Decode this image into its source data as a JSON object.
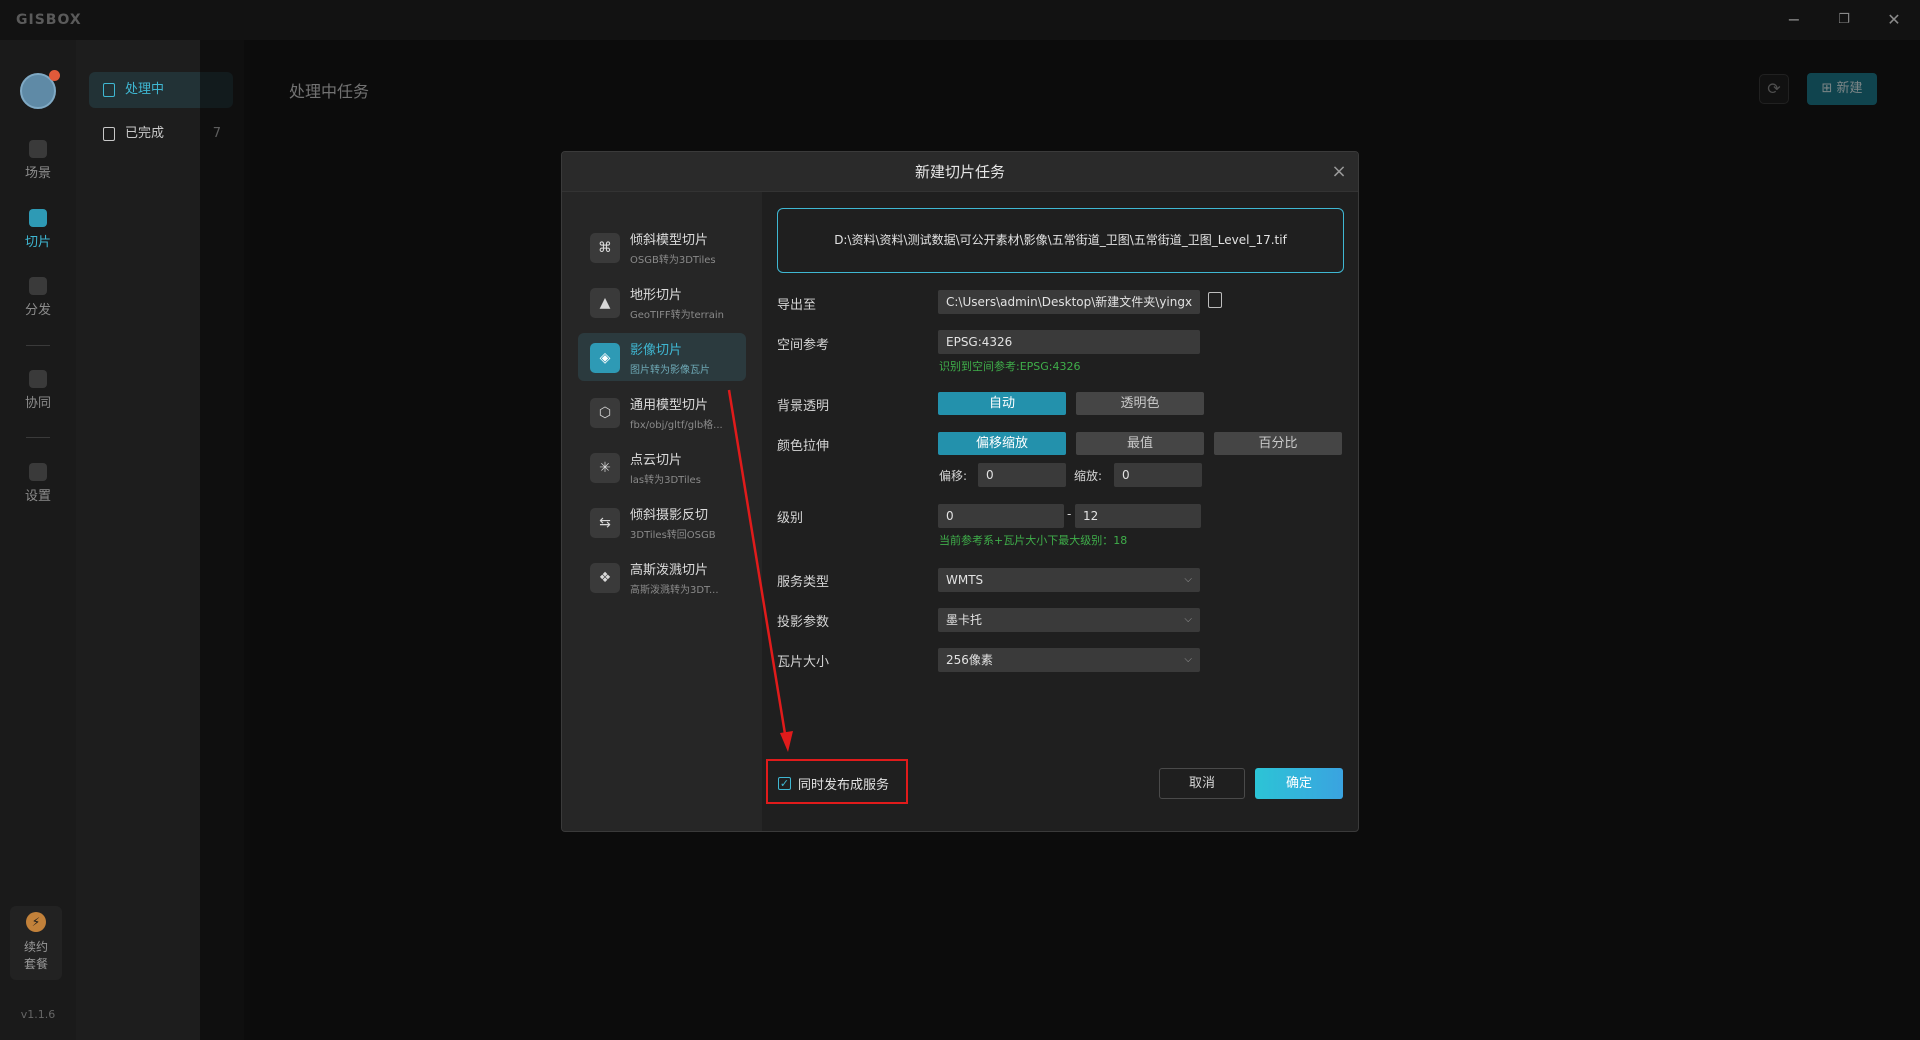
{
  "app": {
    "logo": "GISBOX",
    "version": "v1.1.6",
    "window_controls": {
      "minimize": "−",
      "restore": "❐",
      "close": "✕"
    }
  },
  "rail": {
    "items": [
      {
        "label": "场景",
        "icon": "home-icon"
      },
      {
        "label": "切片",
        "icon": "slice-icon"
      },
      {
        "label": "分发",
        "icon": "distribute-icon"
      },
      {
        "label": "协同",
        "icon": "lock-icon"
      },
      {
        "label": "设置",
        "icon": "gear-icon"
      }
    ],
    "renew": {
      "line1": "续约",
      "line2": "套餐",
      "icon": "bolt-icon"
    }
  },
  "side": {
    "items": [
      {
        "label": "处理中",
        "count": ""
      },
      {
        "label": "已完成",
        "count": "7"
      }
    ]
  },
  "main": {
    "title": "处理中任务",
    "new_label": "新建",
    "refresh_icon": "refresh-icon"
  },
  "dialog": {
    "title": "新建切片任务",
    "close": "×",
    "tasks": [
      {
        "name": "倾斜模型切片",
        "desc": "OSGB转为3DTiles"
      },
      {
        "name": "地形切片",
        "desc": "GeoTIFF转为terrain"
      },
      {
        "name": "影像切片",
        "desc": "图片转为影像瓦片"
      },
      {
        "name": "通用模型切片",
        "desc": "fbx/obj/gltf/glb格..."
      },
      {
        "name": "点云切片",
        "desc": "las转为3DTiles"
      },
      {
        "name": "倾斜摄影反切",
        "desc": "3DTiles转回OSGB"
      },
      {
        "name": "高斯泼溅切片",
        "desc": "高斯泼溅转为3DT..."
      }
    ],
    "file_path": "D:\\资料\\资料\\测试数据\\可公开素材\\影像\\五常街道_卫图\\五常街道_卫图_Level_17.tif",
    "fields": {
      "export_label": "导出至",
      "export_value": "C:\\Users\\admin\\Desktop\\新建文件夹\\yingxiang",
      "spatial_label": "空间参考",
      "spatial_value": "EPSG:4326",
      "spatial_hint": "识别到空间参考:EPSG:4326",
      "bg_label": "背景透明",
      "bg_options": [
        "自动",
        "透明色"
      ],
      "stretch_label": "颜色拉伸",
      "stretch_options": [
        "偏移缩放",
        "最值",
        "百分比"
      ],
      "offset_label": "偏移:",
      "offset_value": "0",
      "scale_label": "缩放:",
      "scale_value": "0",
      "level_label": "级别",
      "level_min": "0",
      "level_sep": "-",
      "level_max": "12",
      "level_hint": "当前参考系+瓦片大小下最大级别：18",
      "service_label": "服务类型",
      "service_value": "WMTS",
      "proj_label": "投影参数",
      "proj_value": "墨卡托",
      "tile_label": "瓦片大小",
      "tile_value": "256像素"
    },
    "publish_label": "同时发布成服务",
    "publish_checked": "✓",
    "cancel": "取消",
    "ok": "确定"
  },
  "colors": {
    "accent": "#3fb7d2",
    "annotation": "#e01b1b",
    "hint": "#3fae4a"
  }
}
